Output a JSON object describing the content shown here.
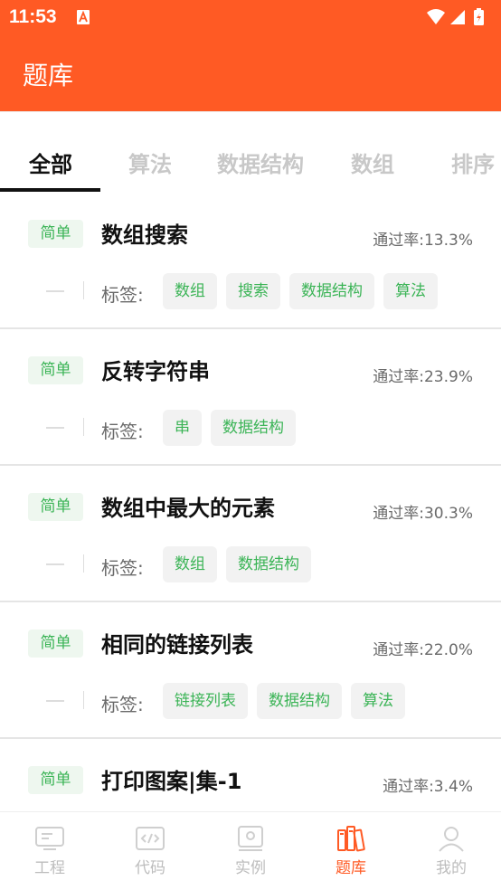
{
  "status": {
    "time": "11:53"
  },
  "appbar": {
    "title": "题库"
  },
  "tabs": [
    {
      "label": "全部",
      "active": true
    },
    {
      "label": "算法"
    },
    {
      "label": "数据结构"
    },
    {
      "label": "数组"
    },
    {
      "label": "排序"
    }
  ],
  "tag_prefix": "标签:",
  "problems": [
    {
      "difficulty": "简单",
      "title": "数组搜索",
      "pass_rate": "通过率:13.3%",
      "tags": [
        "数组",
        "搜索",
        "数据结构",
        "算法"
      ]
    },
    {
      "difficulty": "简单",
      "title": "反转字符串",
      "pass_rate": "通过率:23.9%",
      "tags": [
        "串",
        "数据结构"
      ]
    },
    {
      "difficulty": "简单",
      "title": "数组中最大的元素",
      "pass_rate": "通过率:30.3%",
      "tags": [
        "数组",
        "数据结构"
      ]
    },
    {
      "difficulty": "简单",
      "title": "相同的链接列表",
      "pass_rate": "通过率:22.0%",
      "tags": [
        "链接列表",
        "数据结构",
        "算法"
      ]
    },
    {
      "difficulty": "简单",
      "title": "打印图案|集-1",
      "pass_rate": "通过率:3.4%",
      "tags": []
    }
  ],
  "bottom_nav": [
    {
      "label": "工程",
      "icon": "project-icon"
    },
    {
      "label": "代码",
      "icon": "code-icon"
    },
    {
      "label": "实例",
      "icon": "example-icon"
    },
    {
      "label": "题库",
      "icon": "question-bank-icon",
      "active": true
    },
    {
      "label": "我的",
      "icon": "profile-icon"
    }
  ],
  "colors": {
    "primary": "#ff5a24",
    "tag_green": "#3bb456",
    "inactive": "#bdbdbd"
  }
}
